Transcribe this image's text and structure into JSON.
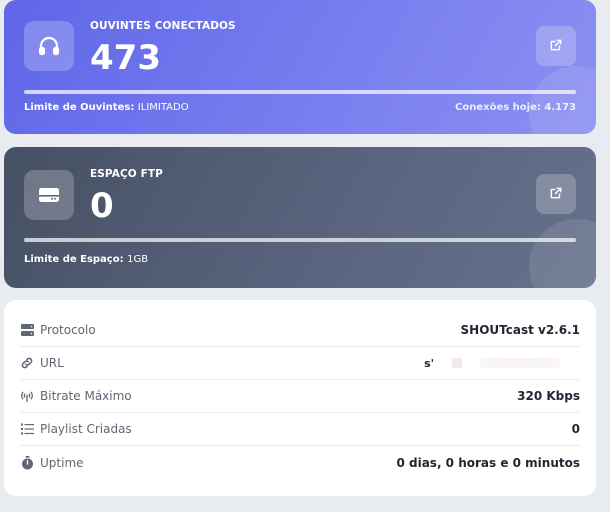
{
  "listeners_card": {
    "label": "OUVINTES CONECTADOS",
    "value": "473",
    "icon": "headphones-icon",
    "limit_label": "Limite de Ouvintes:",
    "limit_value": "ILIMITADO",
    "connections_today": "Conexões hoje: 4.173",
    "progress": 1.0,
    "gradient_start": "#5f66e8",
    "gradient_end": "#8b90f0"
  },
  "ftp_card": {
    "label": "ESPAÇO FTP",
    "value": "0",
    "icon": "hard-drive-icon",
    "limit_label": "Limite de Espaço:",
    "limit_value": "1GB",
    "progress": 1.0,
    "gradient_start": "#465063",
    "gradient_end": "#66718c"
  },
  "info": {
    "rows": [
      {
        "label": "Protocolo",
        "value": "SHOUTcast v2.6.1",
        "icon": "server-icon"
      },
      {
        "label": "URL",
        "value": "s'",
        "icon": "link-icon"
      },
      {
        "label": "Bitrate Máximo",
        "value": "320 Kbps",
        "icon": "broadcast-icon"
      },
      {
        "label": "Playlist Criadas",
        "value": "0",
        "icon": "list-icon"
      },
      {
        "label": "Uptime",
        "value": "0 dias, 0 horas e 0 minutos",
        "icon": "stopwatch-icon"
      }
    ]
  }
}
